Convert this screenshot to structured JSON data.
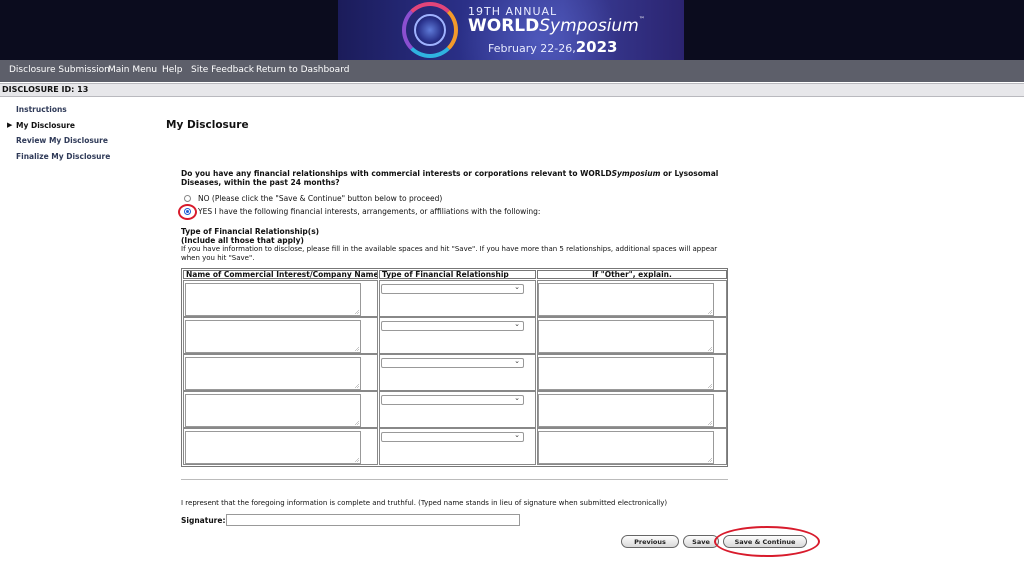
{
  "banner": {
    "line1": "19TH ANNUAL",
    "brand_main": "WORLD",
    "brand_italic": "Symposium",
    "brand_tm": "™",
    "dates": "February 22-26,",
    "year": "2023"
  },
  "nav": {
    "items": [
      "Disclosure Submission",
      "Main Menu",
      "Help",
      "Site Feedback",
      "Return to Dashboard"
    ]
  },
  "disclosure_id": "DISCLOSURE ID: 13",
  "sidebar": {
    "current_marker": "▶",
    "items": [
      "Instructions",
      "My Disclosure",
      "Review My Disclosure",
      "Finalize My Disclosure"
    ]
  },
  "page_title": "My Disclosure",
  "question": {
    "text_before": "Do you have any financial relationships with commercial interests or corporations relevant to WORLD",
    "text_italic": "Symposium",
    "text_after": " or Lysosomal Diseases, within the past 24 months?",
    "options": [
      {
        "label": "NO (Please click the \"Save & Continue\" button below to proceed)",
        "checked": false
      },
      {
        "label": "YES I have the following financial interests, arrangements, or affiliations with the following:",
        "checked": true
      }
    ]
  },
  "relationships": {
    "heading": "Type of Financial Relationship(s)",
    "subheading": "(Include all those that apply)",
    "description": "If you have information to disclose, please fill in the available spaces and hit \"Save\". If you have more than 5 relationships, additional spaces will appear when you hit \"Save\".",
    "columns": [
      "Name of Commercial Interest/Company Name",
      "Type of Financial Relationship",
      "If \"Other\", explain."
    ],
    "rows": [
      {
        "company": "",
        "type": "",
        "other": ""
      },
      {
        "company": "",
        "type": "",
        "other": ""
      },
      {
        "company": "",
        "type": "",
        "other": ""
      },
      {
        "company": "",
        "type": "",
        "other": ""
      },
      {
        "company": "",
        "type": "",
        "other": ""
      }
    ]
  },
  "attestation": "I represent that the foregoing information is complete and truthful. (Typed name stands in lieu of signature when submitted electronically)",
  "signature": {
    "label": "Signature:",
    "value": ""
  },
  "buttons": {
    "previous": "Previous",
    "save": "Save",
    "save_continue": "Save & Continue"
  },
  "colors": {
    "highlight": "#d81b2c",
    "nav_bg": "#5d5f6a",
    "sidebar_link": "#2f3a58"
  },
  "icons": {
    "dropdown": "chevron-down-icon",
    "current": "triangle-right-icon"
  }
}
